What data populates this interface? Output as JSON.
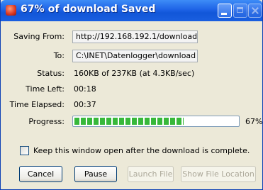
{
  "window": {
    "title": "67% of download Saved",
    "icon": "download-icon"
  },
  "fields": {
    "saving_from_label": "Saving From:",
    "saving_from_value": "http://192.168.192.1/download",
    "to_label": "To:",
    "to_value": "C:\\INET\\Datenlogger\\download",
    "status_label": "Status:",
    "status_value": "160KB of 237KB (at 4.3KB/sec)",
    "time_left_label": "Time Left:",
    "time_left_value": "00:18",
    "time_elapsed_label": "Time Elapsed:",
    "time_elapsed_value": "00:37",
    "progress_label": "Progress:",
    "progress_percent_text": "67%",
    "progress_fraction": 0.67
  },
  "options": {
    "keep_open_label": "Keep this window open after the download is complete.",
    "keep_open_checked": false
  },
  "buttons": {
    "cancel": "Cancel",
    "pause": "Pause",
    "launch_file": "Launch File",
    "show_file_location": "Show File Location"
  },
  "colors": {
    "titlebar": "#1e63e6",
    "progress_fill": "#37b83a",
    "window_bg": "#ece9d8"
  }
}
